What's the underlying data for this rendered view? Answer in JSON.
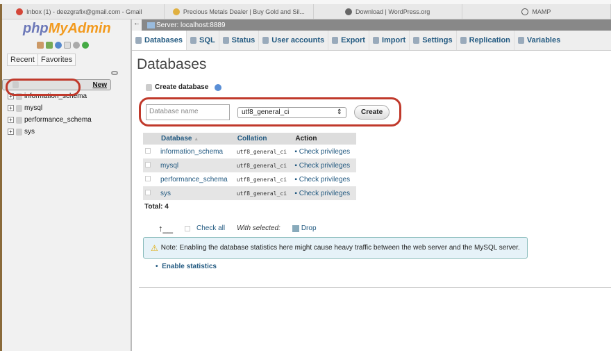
{
  "browser_tabs": [
    {
      "label": "Inbox (1) - deezgrafix@gmail.com - Gmail",
      "icon": "gmail-icon",
      "color": "#d44638"
    },
    {
      "label": "Precious Metals Dealer | Buy Gold and Sil...",
      "icon": "coins-icon",
      "color": "#e0b040"
    },
    {
      "label": "Download | WordPress.org",
      "icon": "wordpress-icon",
      "color": "#555555"
    },
    {
      "label": "MAMP",
      "icon": "mamp-icon",
      "color": "#555555"
    }
  ],
  "sidebar": {
    "logo_php": "php",
    "logo_my": "MyAdmin",
    "recent": "Recent",
    "favorites": "Favorites",
    "tree": [
      {
        "label": "New"
      },
      {
        "label": "information_schema"
      },
      {
        "label": "mysql"
      },
      {
        "label": "performance_schema"
      },
      {
        "label": "sys"
      }
    ]
  },
  "server": {
    "label": "Server: localhost:8889"
  },
  "nav": [
    {
      "label": "Databases"
    },
    {
      "label": "SQL"
    },
    {
      "label": "Status"
    },
    {
      "label": "User accounts"
    },
    {
      "label": "Export"
    },
    {
      "label": "Import"
    },
    {
      "label": "Settings"
    },
    {
      "label": "Replication"
    },
    {
      "label": "Variables"
    }
  ],
  "page_title": "Databases",
  "create": {
    "label": "Create database",
    "placeholder": "Database name",
    "collation": "utf8_general_ci",
    "button": "Create"
  },
  "table": {
    "headers": [
      "Database",
      "Collation",
      "Action"
    ],
    "rows": [
      {
        "name": "information_schema",
        "collation": "utf8_general_ci",
        "action": "Check privileges"
      },
      {
        "name": "mysql",
        "collation": "utf8_general_ci",
        "action": "Check privileges"
      },
      {
        "name": "performance_schema",
        "collation": "utf8_general_ci",
        "action": "Check privileges"
      },
      {
        "name": "sys",
        "collation": "utf8_general_ci",
        "action": "Check privileges"
      }
    ]
  },
  "total": "Total: 4",
  "bulk": {
    "check_all": "Check all",
    "with_selected": "With selected:",
    "drop": "Drop"
  },
  "note": "Note: Enabling the database statistics here might cause heavy traffic between the web server and the MySQL server.",
  "enable_stats": "Enable statistics",
  "highlight_color": "#c0392b"
}
